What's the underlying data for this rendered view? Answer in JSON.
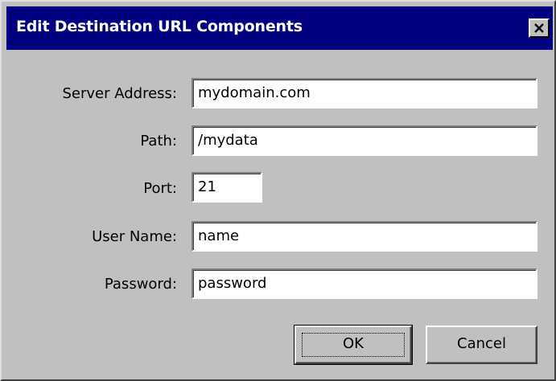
{
  "window": {
    "title": "Edit Destination URL Components",
    "close_icon": "close-icon"
  },
  "form": {
    "server_address": {
      "label": "Server Address:",
      "value": "mydomain.com"
    },
    "path": {
      "label": "Path:",
      "value": "/mydata"
    },
    "port": {
      "label": "Port:",
      "value": "21"
    },
    "user_name": {
      "label": "User Name:",
      "value": "name"
    },
    "password": {
      "label": "Password:",
      "value": "password"
    }
  },
  "buttons": {
    "ok_label": "OK",
    "cancel_label": "Cancel"
  },
  "colors": {
    "titlebar": "#000080",
    "face": "#c0c0c0"
  }
}
